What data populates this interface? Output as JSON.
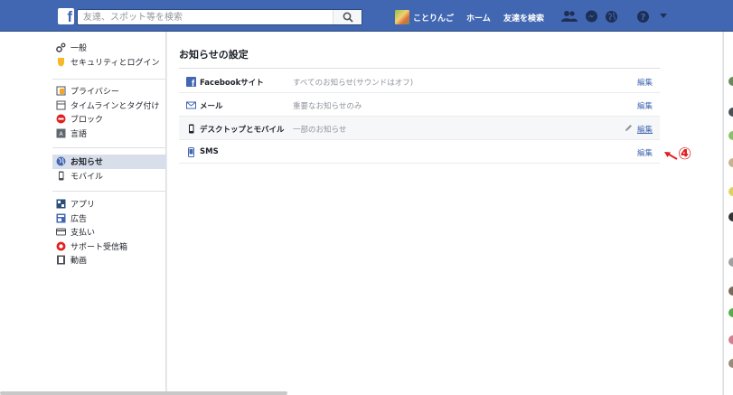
{
  "topbar": {
    "logo": "f",
    "search_placeholder": "友達、スポット等を検索",
    "user_name": "ことりんご",
    "home": "ホーム",
    "find_friends": "友達を検索"
  },
  "sidebar": {
    "groups": [
      [
        {
          "label": "一般",
          "icon": "gear-icon",
          "color": "#606770"
        },
        {
          "label": "セキュリティとログイン",
          "icon": "shield-icon",
          "color": "#f7b928"
        }
      ],
      [
        {
          "label": "プライバシー",
          "icon": "lock-icon",
          "color": "#f5a623"
        },
        {
          "label": "タイムラインとタグ付け",
          "icon": "timeline-icon",
          "color": "#4b4f56"
        },
        {
          "label": "ブロック",
          "icon": "block-icon",
          "color": "#e02020"
        },
        {
          "label": "言語",
          "icon": "language-icon",
          "color": "#4b4f56"
        }
      ],
      [
        {
          "label": "お知らせ",
          "icon": "globe-icon",
          "color": "#4267b2",
          "selected": true
        },
        {
          "label": "モバイル",
          "icon": "mobile-icon",
          "color": "#4b4f56"
        }
      ],
      [
        {
          "label": "アプリ",
          "icon": "apps-icon",
          "color": "#2a4d7a"
        },
        {
          "label": "広告",
          "icon": "ads-icon",
          "color": "#4267b2"
        },
        {
          "label": "支払い",
          "icon": "payments-icon",
          "color": "#4b4f56"
        },
        {
          "label": "サポート受信箱",
          "icon": "support-icon",
          "color": "#e02020"
        },
        {
          "label": "動画",
          "icon": "video-icon",
          "color": "#4b4f56"
        }
      ]
    ]
  },
  "main": {
    "title": "お知らせの設定",
    "rows": [
      {
        "name": "Facebookサイト",
        "value": "すべてのお知らせ(サウンドはオフ)",
        "edit": "編集",
        "icon": "facebook-icon",
        "highlight": false
      },
      {
        "name": "メール",
        "value": "重要なお知らせのみ",
        "edit": "編集",
        "icon": "mail-icon",
        "highlight": false
      },
      {
        "name": "デスクトップとモバイル",
        "value": "一部のお知らせ",
        "edit": "編集",
        "icon": "mobile-icon",
        "highlight": true
      },
      {
        "name": "SMS",
        "value": "",
        "edit": "編集",
        "icon": "sms-icon",
        "highlight": false
      }
    ]
  },
  "annotation": {
    "label": "④",
    "color": "#e02020"
  },
  "colors": {
    "brand": "#4267b2",
    "link": "#4267b2",
    "selected_bg": "#d8dfea"
  }
}
